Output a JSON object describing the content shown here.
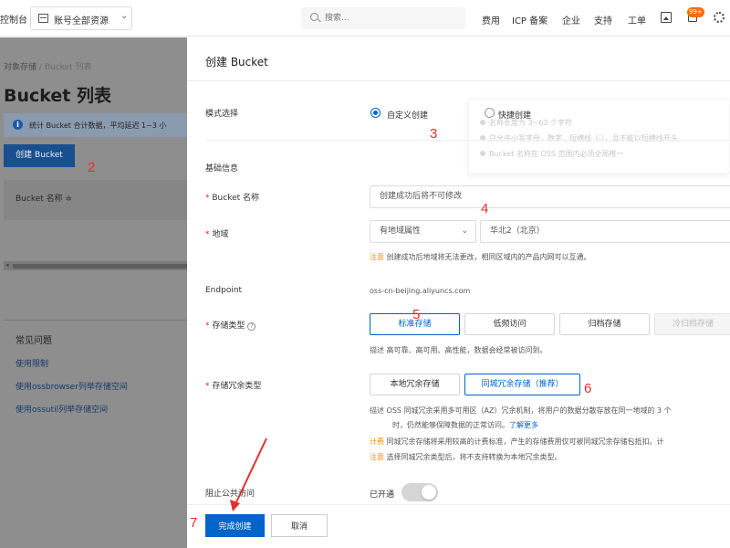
{
  "topbar": {
    "console_label": "控制台",
    "account_label": "账号全部资源",
    "search_placeholder": "搜索...",
    "nav": [
      "费用",
      "ICP 备案",
      "企业",
      "支持",
      "工单"
    ],
    "badge": "99+"
  },
  "left": {
    "breadcrumb": {
      "root": "对象存储",
      "sep": "/",
      "current": "Bucket 列表"
    },
    "title": "Bucket 列表",
    "info_text": "统计 Bucket 合计数据，平均延迟 1~3 小",
    "create_button": "创建 Bucket",
    "table_header": "Bucket 名称 ≑",
    "faq": {
      "heading": "常见问题",
      "links": [
        "使用限制",
        "使用ossbrowser列举存储空间",
        "使用ossutil列举存储空间"
      ]
    }
  },
  "panel": {
    "title": "创建 Bucket",
    "mode": {
      "label": "模式选择",
      "custom": "自定义创建",
      "quick": "快捷创建",
      "tips": [
        "名称长度为 3~63 个字符",
        "只允许小写字母、数字、短横线（-），且不能以短横线开头",
        "Bucket 名称在 OSS 范围内必须全局唯一"
      ]
    },
    "basic_section": "基础信息",
    "bucket_name": {
      "label": "Bucket 名称",
      "placeholder": "创建成功后将不可修改"
    },
    "region": {
      "label": "地域",
      "attr_select": "有地域属性",
      "region_select": "华北2（北京）",
      "note_key": "注意",
      "note": "创建成功后地域将无法更改，相同区域内的产品内网可以互通。"
    },
    "endpoint": {
      "label": "Endpoint",
      "value": "oss-cn-beijing.aliyuncs.com"
    },
    "storage_class": {
      "label": "存储类型",
      "options": [
        "标准存储",
        "低频访问",
        "归档存储",
        "冷归档存储"
      ],
      "desc_key": "描述",
      "desc": "高可靠、高可用、高性能，数据会经常被访问到。"
    },
    "redundancy": {
      "label": "存储冗余类型",
      "options": [
        "本地冗余存储",
        "同城冗余存储（推荐）"
      ],
      "desc_key": "描述",
      "desc1": "OSS 同城冗余采用多可用区（AZ）冗余机制，将用户的数据分散存放在同一地域的 3 个",
      "desc2": "时，仍然能够保障数据的正常访问。",
      "learn_more": "了解更多",
      "fee_key": "计费",
      "fee": "同城冗余存储将采用较高的计费标准，产生的存储费用仅可被同城冗余存储包抵扣。计",
      "warn_key": "注意",
      "warn": "选择同城冗余类型后，将不支持转换为本地冗余类型。"
    },
    "block_public": {
      "label": "阻止公共访问",
      "status": "已开通"
    },
    "footer": {
      "ok": "完成创建",
      "cancel": "取消"
    }
  },
  "annotations": [
    "2",
    "3",
    "4",
    "5",
    "6",
    "7"
  ],
  "colors": {
    "primary": "#0064c8",
    "annotation": "#e52f2f",
    "notice": "#ff8a00"
  }
}
